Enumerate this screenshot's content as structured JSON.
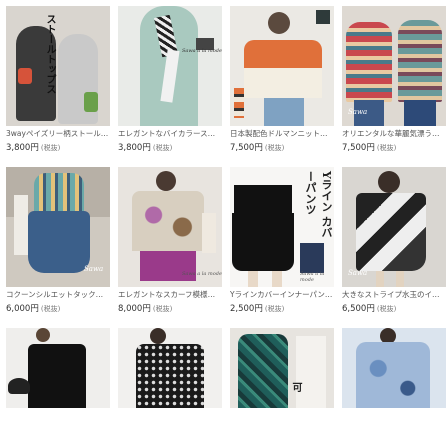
{
  "products": [
    {
      "title": "3wayペイズリー柄ストールト...",
      "price": "3,800円",
      "tax": "(税抜)",
      "overlay_text": "ストールトップス",
      "logo": ""
    },
    {
      "title": "エレガントなバイカラースカーフ...",
      "price": "3,800円",
      "tax": "(税抜)",
      "overlay_text": "",
      "logo": "Sawa a la mode"
    },
    {
      "title": "日本製配色ドルマンニットトップ...",
      "price": "7,500円",
      "tax": "(税抜)",
      "overlay_text": "",
      "logo": ""
    },
    {
      "title": "オリエンタルな華麗気漂うエスニ...",
      "price": "7,500円",
      "tax": "(税抜)",
      "overlay_text": "",
      "logo": "Sawa"
    },
    {
      "title": "コクーンシルエットタックデニム...",
      "price": "6,000円",
      "tax": "(税抜)",
      "overlay_text": "",
      "logo": "Sawa"
    },
    {
      "title": "エレガントなスカーフ模様ワンピ...",
      "price": "8,000円",
      "tax": "(税抜)",
      "overlay_text": "",
      "logo": "Sawa a la mode"
    },
    {
      "title": "Yラインカバーインナーパンツ【...",
      "price": "2,500円",
      "tax": "(税抜)",
      "overlay_text": "Yライン カバーパンツ",
      "logo": "Sawa a la mode"
    },
    {
      "title": "大きなストライプ水玉のイレギュ...",
      "price": "6,500円",
      "tax": "(税抜)",
      "overlay_text": "",
      "logo": "Sawa"
    },
    {
      "title": "",
      "price": "",
      "tax": "",
      "overlay_text": "",
      "logo": ""
    },
    {
      "title": "",
      "price": "",
      "tax": "",
      "overlay_text": "",
      "logo": ""
    },
    {
      "title": "",
      "price": "",
      "tax": "",
      "overlay_text": "可",
      "logo": ""
    },
    {
      "title": "",
      "price": "",
      "tax": "",
      "overlay_text": "",
      "logo": ""
    }
  ]
}
